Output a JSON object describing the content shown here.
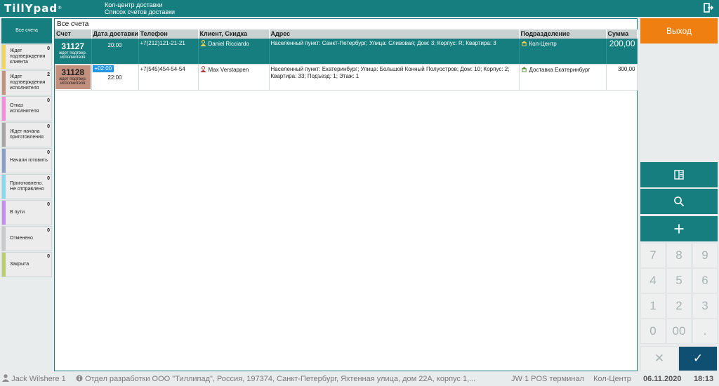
{
  "header": {
    "logo": "TillYpad",
    "logo_mark": "®",
    "title": "Кол-центр доставки",
    "subtitle": "Список счетов доставки"
  },
  "sidebar": {
    "items": [
      {
        "label": "Все счета",
        "count": "",
        "color": "",
        "active": true
      },
      {
        "label": "Ждет подтверждения клиента",
        "count": "0",
        "color": "#f4d55a"
      },
      {
        "label": "Ждет подтверждения исполнителя",
        "count": "2",
        "color": "#c4907e"
      },
      {
        "label": "Отказ исполнителя",
        "count": "0",
        "color": "#f48cd8"
      },
      {
        "label": "Ждет начала приготовления",
        "count": "0",
        "color": "#a8a3a3"
      },
      {
        "label": "Начали готовить",
        "count": "0",
        "color": "#8a9cc8"
      },
      {
        "label": "Приготовлено. Не отправлено",
        "count": "0",
        "color": "#8ad8ee"
      },
      {
        "label": "В пути",
        "count": "0",
        "color": "#c48cee"
      },
      {
        "label": "Отменено",
        "count": "0",
        "color": "#c9c9c9"
      },
      {
        "label": "Закрыта",
        "count": "0",
        "color": "#b9cf6a"
      }
    ]
  },
  "main": {
    "title": "Все счета",
    "columns": [
      "Счет",
      "Дата доставки",
      "Телефон",
      "Клиент, Скидка",
      "Адрес",
      "Подразделение",
      "Сумма"
    ],
    "rows": [
      {
        "number": "31127",
        "status": "ждет подтвер. исполнителя",
        "time_badge": "",
        "time": "20:00",
        "phone": "+7(212)121-21-21",
        "client": "Daniel Ricciardo",
        "address": "Населенный пункт: Санкт-Петербург; Улица: Сливовая; Дом: 3; Корпус: R; Квартира: 3",
        "division": "Кол-Центр",
        "sum": "200,00",
        "selected": true
      },
      {
        "number": "31128",
        "status": "ждет подтвер. исполнителя",
        "time_badge": "+02:00",
        "time": "22:00",
        "phone": "+7(545)454-54-54",
        "client": "Max Verstappen",
        "address": "Населенный пункт: Екатеринбург; Улица: Большой Конный Полуостров; Дом: 10; Корпус: 2; Квартира: 33; Подъезд: 1; Этаж: 1",
        "division": "Доставка Екатеринбург",
        "sum": "300,00",
        "selected": false
      }
    ]
  },
  "right": {
    "exit_label": "Выход",
    "keys": [
      "7",
      "8",
      "9",
      "4",
      "5",
      "6",
      "1",
      "2",
      "3",
      "0",
      "00",
      "."
    ],
    "cancel_glyph": "✕",
    "ok_glyph": "✓"
  },
  "status": {
    "user": "Jack Wilshere 1",
    "org": "Отдел разработки ООО \"Тиллипад\", Россия, 197374, Санкт-Петербург, Яхтенная улица, дом 22А, корпус 1,...",
    "terminal": "JW 1 POS терминал",
    "place": "Кол-Центр",
    "date": "06.11.2020",
    "time": "18:13"
  },
  "colors": {
    "accent": "#167e7e",
    "exit": "#f07f12",
    "ok": "#0e4f72",
    "time_badge": "#2196e8"
  }
}
